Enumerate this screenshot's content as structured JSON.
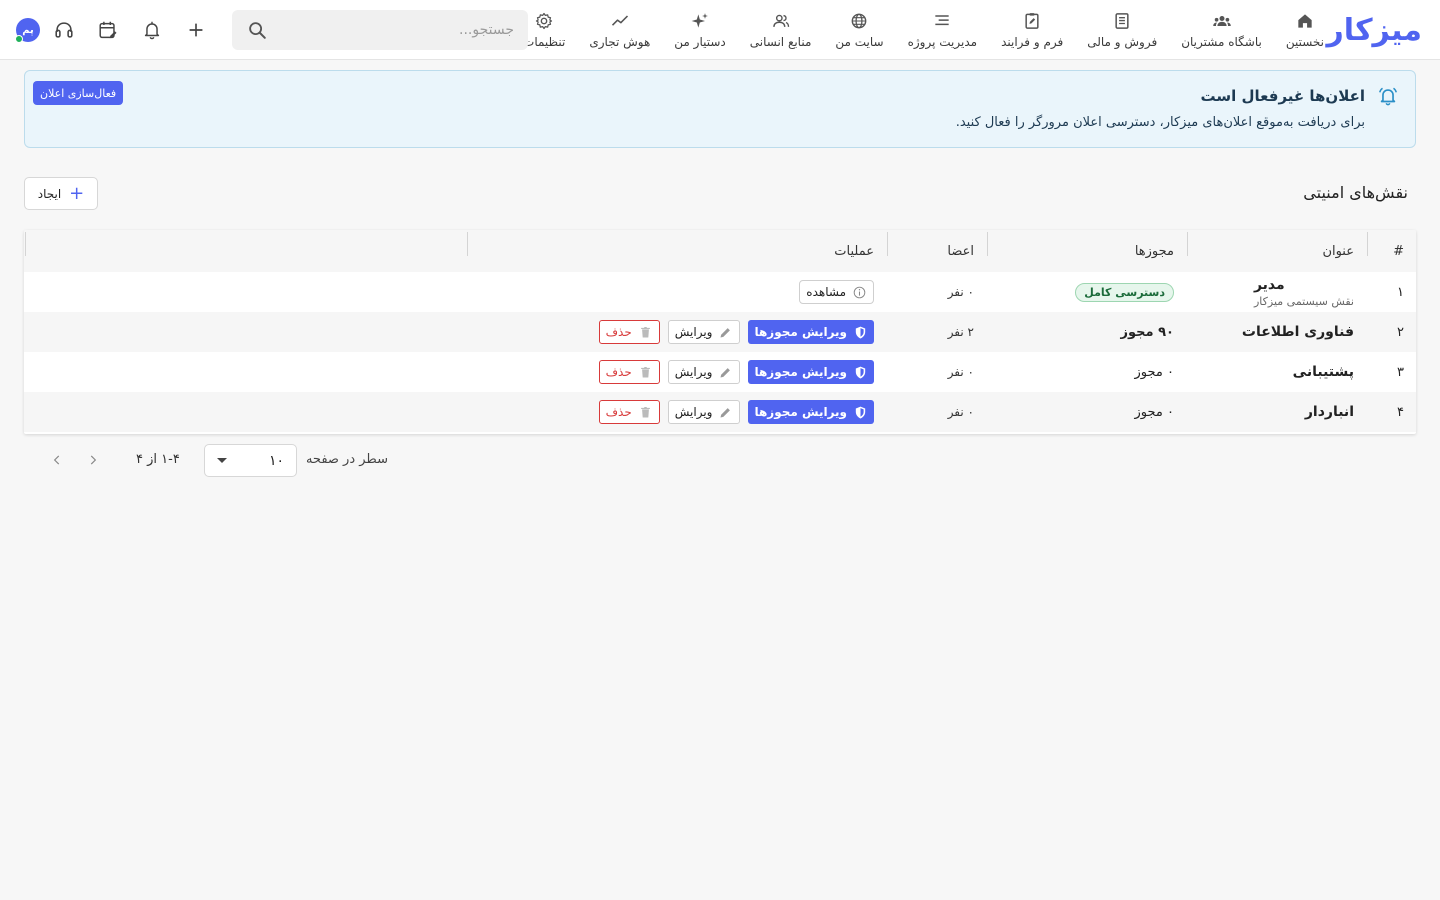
{
  "app": {
    "logo": "میزکار",
    "brand_color": "#5064f0"
  },
  "nav": [
    {
      "label": "نخستین",
      "icon": "home-icon"
    },
    {
      "label": "باشگاه مشتریان",
      "icon": "group-icon"
    },
    {
      "label": "فروش و مالی",
      "icon": "ledger-icon"
    },
    {
      "label": "فرم و فرایند",
      "icon": "form-icon"
    },
    {
      "label": "مدیریت پروژه",
      "icon": "list-icon"
    },
    {
      "label": "سایت من",
      "icon": "globe-icon"
    },
    {
      "label": "منابع انسانی",
      "icon": "people-icon"
    },
    {
      "label": "دستیار من",
      "icon": "sparkle-icon"
    },
    {
      "label": "هوش تجاری",
      "icon": "trend-icon"
    },
    {
      "label": "تنظیمات",
      "icon": "gear-icon"
    }
  ],
  "search": {
    "placeholder": "جستجو..."
  },
  "toolbar": {
    "avatar_initials": "پم"
  },
  "alert": {
    "title": "اعلان‌ها غیرفعال است",
    "text": "برای دریافت به‌موقع اعلان‌های میزکار، دسترسی اعلان مرورگر را فعال کنید.",
    "button": "فعال‌سازی اعلان"
  },
  "page": {
    "title": "نقش‌های امنیتی",
    "create_label": "ایجاد"
  },
  "table": {
    "headers": {
      "index": "#",
      "title": "عنوان",
      "permissions": "مجوزها",
      "members": "اعضا",
      "operations": "عملیات"
    },
    "rows": [
      {
        "index": "۱",
        "title": "مدیر",
        "subtitle": "نقش سیستمی میزکار",
        "permissions": "دسترسی کامل",
        "members": "۰ نفر",
        "view": "مشاهده"
      },
      {
        "index": "۲",
        "title": "فناوری اطلاعات",
        "permissions": "۹۰ مجوز",
        "members": "۲ نفر",
        "edit_perms": "ویرایش مجوزها",
        "edit": "ویرایش",
        "delete": "حذف"
      },
      {
        "index": "۳",
        "title": "پشتیبانی",
        "permissions": "۰ مجوز",
        "members": "۰ نفر",
        "edit_perms": "ویرایش مجوزها",
        "edit": "ویرایش",
        "delete": "حذف"
      },
      {
        "index": "۴",
        "title": "انباردار",
        "permissions": "۰ مجوز",
        "members": "۰ نفر",
        "edit_perms": "ویرایش مجوزها",
        "edit": "ویرایش",
        "delete": "حذف"
      }
    ]
  },
  "pagination": {
    "rows_label": "سطر در صفحه",
    "rows_per_page": "۱۰",
    "range": "۱-۴ از ۴"
  }
}
